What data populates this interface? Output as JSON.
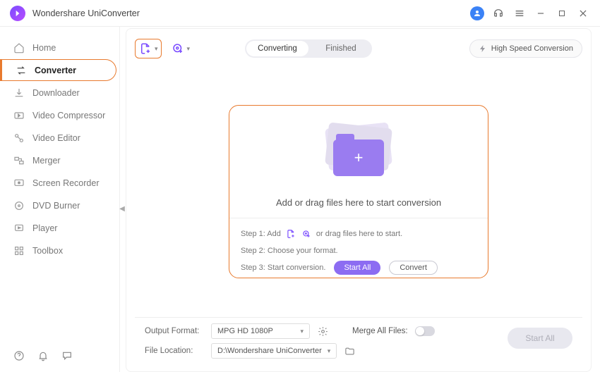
{
  "app_title": "Wondershare UniConverter",
  "sidebar": {
    "items": [
      {
        "label": "Home",
        "icon": "home-icon"
      },
      {
        "label": "Converter",
        "icon": "converter-icon",
        "active": true
      },
      {
        "label": "Downloader",
        "icon": "downloader-icon"
      },
      {
        "label": "Video Compressor",
        "icon": "compressor-icon"
      },
      {
        "label": "Video Editor",
        "icon": "editor-icon"
      },
      {
        "label": "Merger",
        "icon": "merger-icon"
      },
      {
        "label": "Screen Recorder",
        "icon": "recorder-icon"
      },
      {
        "label": "DVD Burner",
        "icon": "dvd-icon"
      },
      {
        "label": "Player",
        "icon": "player-icon"
      },
      {
        "label": "Toolbox",
        "icon": "toolbox-icon"
      }
    ]
  },
  "tabs": {
    "converting": "Converting",
    "finished": "Finished",
    "active": "converting"
  },
  "high_speed_label": "High Speed Conversion",
  "dropzone": {
    "main_text": "Add or drag files here to start conversion",
    "step1_prefix": "Step 1: Add",
    "step1_suffix": "or drag files here to start.",
    "step2": "Step 2: Choose your format.",
    "step3": "Step 3: Start conversion.",
    "start_all_pill": "Start All",
    "convert_pill": "Convert"
  },
  "bottom": {
    "output_format_label": "Output Format:",
    "output_format_value": "MPG HD 1080P",
    "merge_label": "Merge All Files:",
    "file_location_label": "File Location:",
    "file_location_value": "D:\\Wondershare UniConverter",
    "start_all": "Start All"
  },
  "colors": {
    "accent_orange": "#e87a2e",
    "accent_purple": "#8c6cf2"
  }
}
